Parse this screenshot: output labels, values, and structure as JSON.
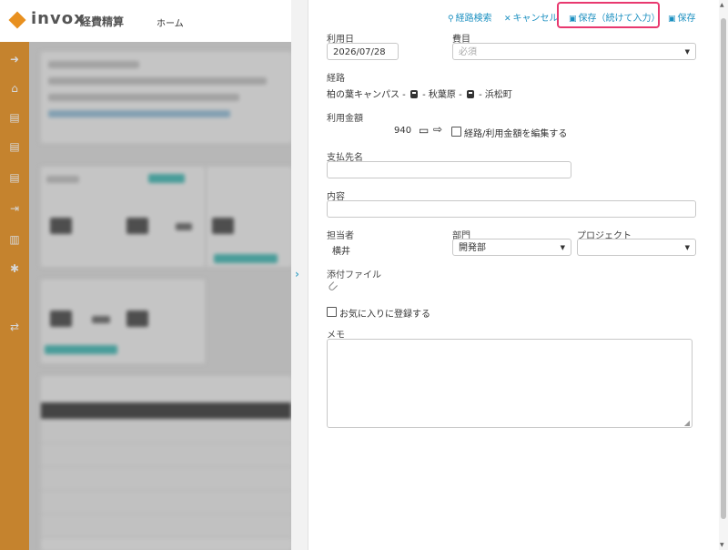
{
  "app": {
    "logo_text": "invox",
    "logo_sub": "経費精算",
    "home_link": "ホーム",
    "brand_color": "#e8901f"
  },
  "sidebar_icons": [
    "arrow-right-circle-icon",
    "home-icon",
    "document-icon",
    "document-icon",
    "document-icon",
    "export-icon",
    "chart-icon",
    "gear-icon",
    "transfer-icon"
  ],
  "toolbar": {
    "route_search": "経路検索",
    "cancel": "キャンセル",
    "save_continue": "保存（続けて入力）",
    "save": "保存",
    "link_color": "#1a8fc0",
    "highlight_color": "#e8386f"
  },
  "form": {
    "date_label": "利用日",
    "date_value": "2026/07/28",
    "expense_label": "費目",
    "expense_placeholder": "必須",
    "route_label": "経路",
    "route_from": "柏の葉キャンパス - ",
    "route_mid": " - 秋葉原 - ",
    "route_to": " - 浜松町",
    "amount_label": "利用金額",
    "amount_value": "940",
    "edit_route_label": "経路/利用金額を編集する",
    "payee_label": "支払先名",
    "content_label": "内容",
    "person_label": "担当者",
    "person_value": "横井",
    "dept_label": "部門",
    "dept_value": "開発部",
    "project_label": "プロジェクト",
    "attachment_label": "添付ファイル",
    "favorite_label": "お気に入りに登録する",
    "memo_label": "メモ"
  }
}
